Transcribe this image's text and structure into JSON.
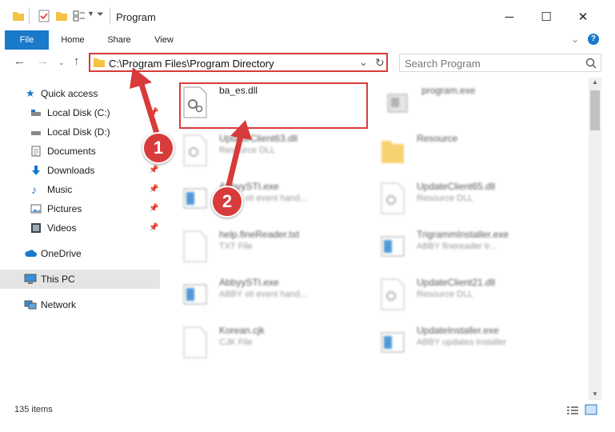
{
  "window": {
    "title": "Program",
    "minimize": "─",
    "maximize": "☐",
    "close": "✕"
  },
  "ribbon": {
    "tabs": [
      "File",
      "Home",
      "Share",
      "View"
    ]
  },
  "address": {
    "path": "C:\\Program Files\\Program Directory",
    "refresh": "↻",
    "dropdown": "⌄"
  },
  "search": {
    "placeholder": "Search Program"
  },
  "sidebar": {
    "items": [
      {
        "label": "Quick access",
        "icon": "star-icon"
      },
      {
        "label": "Local Disk (C:)",
        "icon": "drive-icon"
      },
      {
        "label": "Local Disk (D:)",
        "icon": "drive-icon"
      },
      {
        "label": "Documents",
        "icon": "documents-icon"
      },
      {
        "label": "Downloads",
        "icon": "download-icon"
      },
      {
        "label": "Music",
        "icon": "music-icon"
      },
      {
        "label": "Pictures",
        "icon": "pictures-icon"
      },
      {
        "label": "Videos",
        "icon": "videos-icon"
      },
      {
        "label": "OneDrive",
        "icon": "cloud-icon"
      },
      {
        "label": "This PC",
        "icon": "computer-icon"
      },
      {
        "label": "Network",
        "icon": "network-icon"
      }
    ]
  },
  "files": [
    {
      "name": "ba_es.dll",
      "sub": ""
    },
    {
      "name": "program.exe",
      "sub": ""
    },
    {
      "name": "UpdateClient63.dll",
      "sub": "Resource DLL"
    },
    {
      "name": "Resource",
      "sub": ""
    },
    {
      "name": "AbbyySTI.exe",
      "sub": "ABBY sti event hand..."
    },
    {
      "name": "UpdateClient65.dll",
      "sub": "Resource DLL"
    },
    {
      "name": "help.fineReader.txt",
      "sub": "TXT File"
    },
    {
      "name": "TrigrammInstaller.exe",
      "sub": "ABBY finereader tr..."
    },
    {
      "name": "AbbyySTI.exe",
      "sub": "ABBY sti event hand..."
    },
    {
      "name": "UpdateClient21.dll",
      "sub": "Resource DLL"
    },
    {
      "name": "Korean.cjk",
      "sub": "CJK File"
    },
    {
      "name": "UpdateInstaller.exe",
      "sub": "ABBY updates installer"
    }
  ],
  "status": {
    "count": "135 items"
  },
  "annotations": {
    "one": "1",
    "two": "2"
  },
  "colors": {
    "accent": "#1979ca",
    "highlight": "#d83b3b",
    "folder": "#f5c342"
  }
}
